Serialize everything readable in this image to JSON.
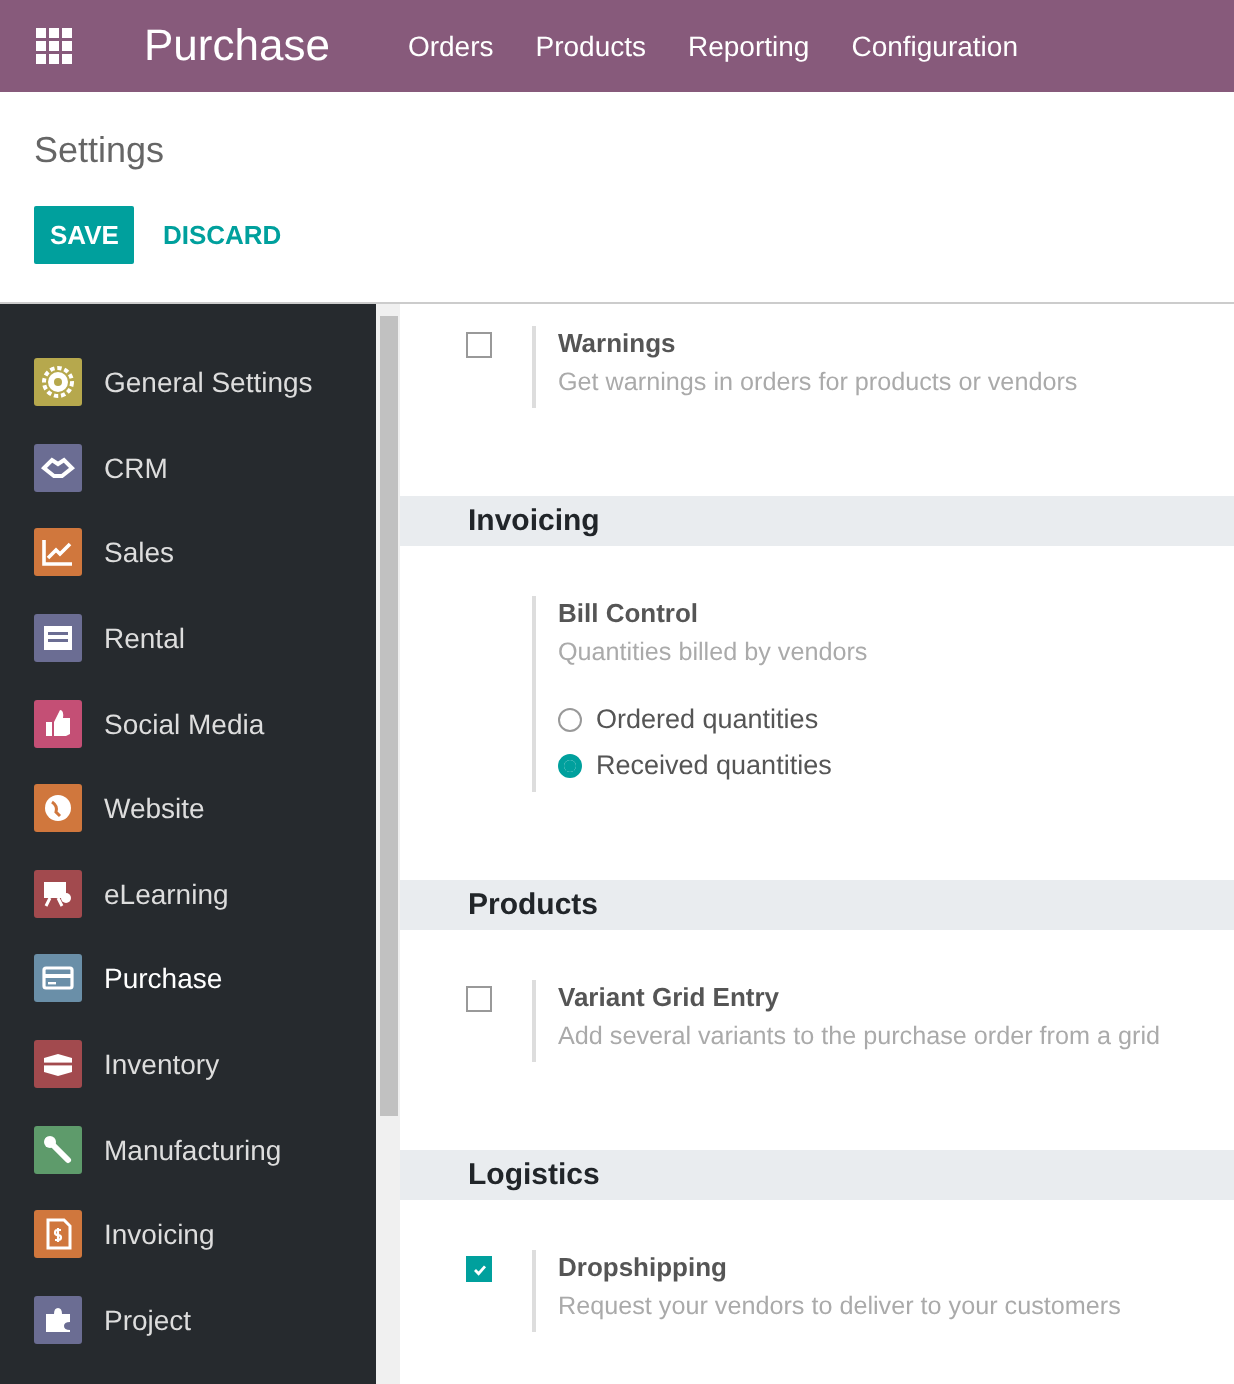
{
  "navbar": {
    "app_title": "Purchase",
    "menu": [
      "Orders",
      "Products",
      "Reporting",
      "Configuration"
    ]
  },
  "control_panel": {
    "breadcrumb": "Settings",
    "buttons": [
      {
        "label": "SAVE",
        "kind": "primary"
      },
      {
        "label": "DISCARD",
        "kind": "secondary"
      }
    ]
  },
  "sidebar": {
    "items": [
      {
        "label": "General Settings",
        "color": "#b6a84d",
        "selected": false
      },
      {
        "label": "CRM",
        "color": "#6b6d93",
        "selected": false
      },
      {
        "label": "Sales",
        "color": "#d0773d",
        "selected": false
      },
      {
        "label": "Rental",
        "color": "#6b6d93",
        "selected": false
      },
      {
        "label": "Social Media",
        "color": "#c44f75",
        "selected": false
      },
      {
        "label": "Website",
        "color": "#d0773d",
        "selected": false
      },
      {
        "label": "eLearning",
        "color": "#a24a4e",
        "selected": false
      },
      {
        "label": "Purchase",
        "color": "#6a8fa8",
        "selected": true
      },
      {
        "label": "Inventory",
        "color": "#a24a4e",
        "selected": false
      },
      {
        "label": "Manufacturing",
        "color": "#5e9b6b",
        "selected": false
      },
      {
        "label": "Invoicing",
        "color": "#d0773d",
        "selected": false
      },
      {
        "label": "Project",
        "color": "#6b6d93",
        "selected": false
      }
    ]
  },
  "sections": [
    {
      "settings": [
        {
          "kind": "checkbox",
          "label": "Warnings",
          "description": "Get warnings in orders for products or vendors",
          "checked": false
        }
      ]
    },
    {
      "title": "Invoicing",
      "settings": [
        {
          "kind": "radio",
          "label": "Bill Control",
          "description": "Quantities billed by vendors",
          "options": [
            {
              "label": "Ordered quantities",
              "selected": false
            },
            {
              "label": "Received quantities",
              "selected": true
            }
          ]
        }
      ]
    },
    {
      "title": "Products",
      "settings": [
        {
          "kind": "checkbox",
          "label": "Variant Grid Entry",
          "description": "Add several variants to the purchase order from a grid",
          "checked": false
        }
      ]
    },
    {
      "title": "Logistics",
      "settings": [
        {
          "kind": "checkbox",
          "label": "Dropshipping",
          "description": "Request your vendors to deliver to your customers",
          "checked": true
        }
      ]
    }
  ]
}
